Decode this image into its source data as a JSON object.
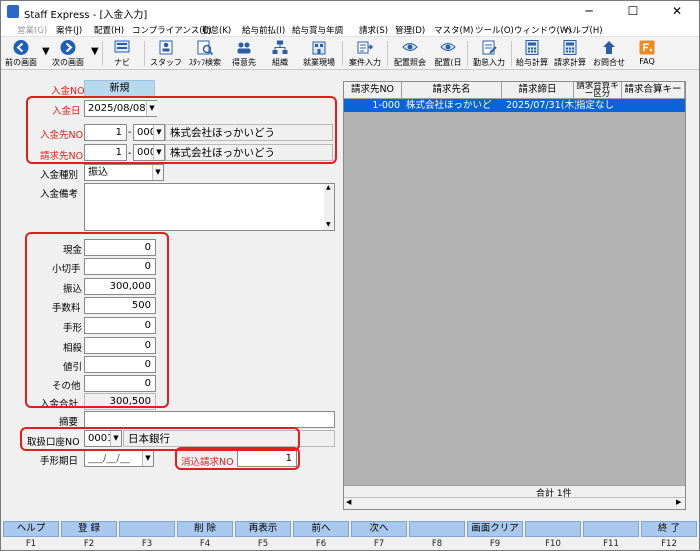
{
  "window": {
    "title": "Staff Express - [入金入力]",
    "minimize": "─",
    "maximize": "☐",
    "close": "✕"
  },
  "menu": [
    {
      "label": "営業(G)",
      "disabled": true
    },
    {
      "label": "案件(J)",
      "disabled": false
    },
    {
      "label": "配置(H)",
      "disabled": false
    },
    {
      "label": "コンプライアンス(C)",
      "disabled": false
    },
    {
      "label": "勤怠(K)",
      "disabled": false
    },
    {
      "label": "給与前払(I)",
      "disabled": false
    },
    {
      "label": "給与賞与年調",
      "disabled": false
    },
    {
      "label": "請求(S)",
      "disabled": false
    },
    {
      "label": "管理(D)",
      "disabled": false
    },
    {
      "label": "マスタ(M)",
      "disabled": false
    },
    {
      "label": "ツール(O)",
      "disabled": false
    },
    {
      "label": "ウィンドウ(W)",
      "disabled": false
    },
    {
      "label": "ヘルプ(H)",
      "disabled": false
    }
  ],
  "toolbar": [
    {
      "label": "前の画面",
      "icon": "arrow-left-icon"
    },
    {
      "label": "次の画面",
      "icon": "arrow-right-icon"
    },
    {
      "label": "ナビ",
      "icon": "navi-icon"
    },
    {
      "label": "スタッフ",
      "icon": "staff-icon"
    },
    {
      "label": "ｽﾀｯﾌ検索",
      "icon": "staff-search-icon"
    },
    {
      "label": "得意先",
      "icon": "customer-icon"
    },
    {
      "label": "組織",
      "icon": "organization-icon"
    },
    {
      "label": "就業現場",
      "icon": "worksite-icon"
    },
    {
      "label": "案件入力",
      "icon": "job-entry-icon"
    },
    {
      "label": "配置照会",
      "icon": "placement-inquiry-icon"
    },
    {
      "label": "配置(日",
      "icon": "placement-daily-icon"
    },
    {
      "label": "勤怠入力",
      "icon": "attendance-entry-icon"
    },
    {
      "label": "給与計算",
      "icon": "payroll-calc-icon"
    },
    {
      "label": "請求計算",
      "icon": "billing-calc-icon"
    },
    {
      "label": "お問合せ",
      "icon": "inquiry-icon"
    },
    {
      "label": "FAQ",
      "icon": "faq-icon"
    }
  ],
  "form": {
    "deposit_no_label": "入金NO",
    "deposit_no_value": "新規",
    "deposit_date_label": "入金日",
    "deposit_date_value": "2025/08/08",
    "payer_no_label": "入金先NO",
    "payer_no_value": "1",
    "payer_branch": "000",
    "payer_name": "株式会社ほっかいどう",
    "billing_no_label": "請求先NO",
    "billing_no_value": "1",
    "billing_branch": "000",
    "billing_name": "株式会社ほっかいどう",
    "deposit_type_label": "入金種別",
    "deposit_type_value": "振込",
    "remarks_label": "入金備考",
    "remarks_value": "",
    "amounts": [
      {
        "label": "現金",
        "value": "0"
      },
      {
        "label": "小切手",
        "value": "0"
      },
      {
        "label": "振込",
        "value": "300,000"
      },
      {
        "label": "手数料",
        "value": "500"
      },
      {
        "label": "手形",
        "value": "0"
      },
      {
        "label": "相殺",
        "value": "0"
      },
      {
        "label": "値引",
        "value": "0"
      },
      {
        "label": "その他",
        "value": "0"
      }
    ],
    "total_label": "入金合計",
    "total_value": "300,500",
    "summary_label": "摘要",
    "summary_value": "",
    "account_label": "取扱口座NO",
    "account_value": "0001",
    "account_bank": "日本銀行",
    "note_due_label": "手形期日",
    "note_due_value": "___/__/__",
    "clear_no_label": "消込請求NO",
    "clear_no_value": "1"
  },
  "grid": {
    "headers": [
      "請求先NO",
      "請求先名",
      "請求締日",
      "請求合算キー区分",
      "請求合算キー"
    ],
    "rows": [
      {
        "no": "1-000",
        "name": "株式会社ほっかいど",
        "date": "2025/07/31(木)",
        "kbn": "指定なし",
        "key": ""
      }
    ],
    "footer": "合計 1件"
  },
  "fkeys": [
    {
      "label": "ヘルプ",
      "key": "F1"
    },
    {
      "label": "登 録",
      "key": "F2"
    },
    {
      "label": "",
      "key": "F3"
    },
    {
      "label": "削 除",
      "key": "F4"
    },
    {
      "label": "再表示",
      "key": "F5"
    },
    {
      "label": "前へ",
      "key": "F6"
    },
    {
      "label": "次へ",
      "key": "F7"
    },
    {
      "label": "",
      "key": "F8"
    },
    {
      "label": "画面クリア",
      "key": "F9"
    },
    {
      "label": "",
      "key": "F10"
    },
    {
      "label": "",
      "key": "F11"
    },
    {
      "label": "終 了",
      "key": "F12"
    }
  ],
  "colors": {
    "accent_red": "#e0201c",
    "selection_blue": "#0a64d8",
    "fkey_blue": "#a8c8ee",
    "deposit_no_bg": "#b8d8ee"
  }
}
